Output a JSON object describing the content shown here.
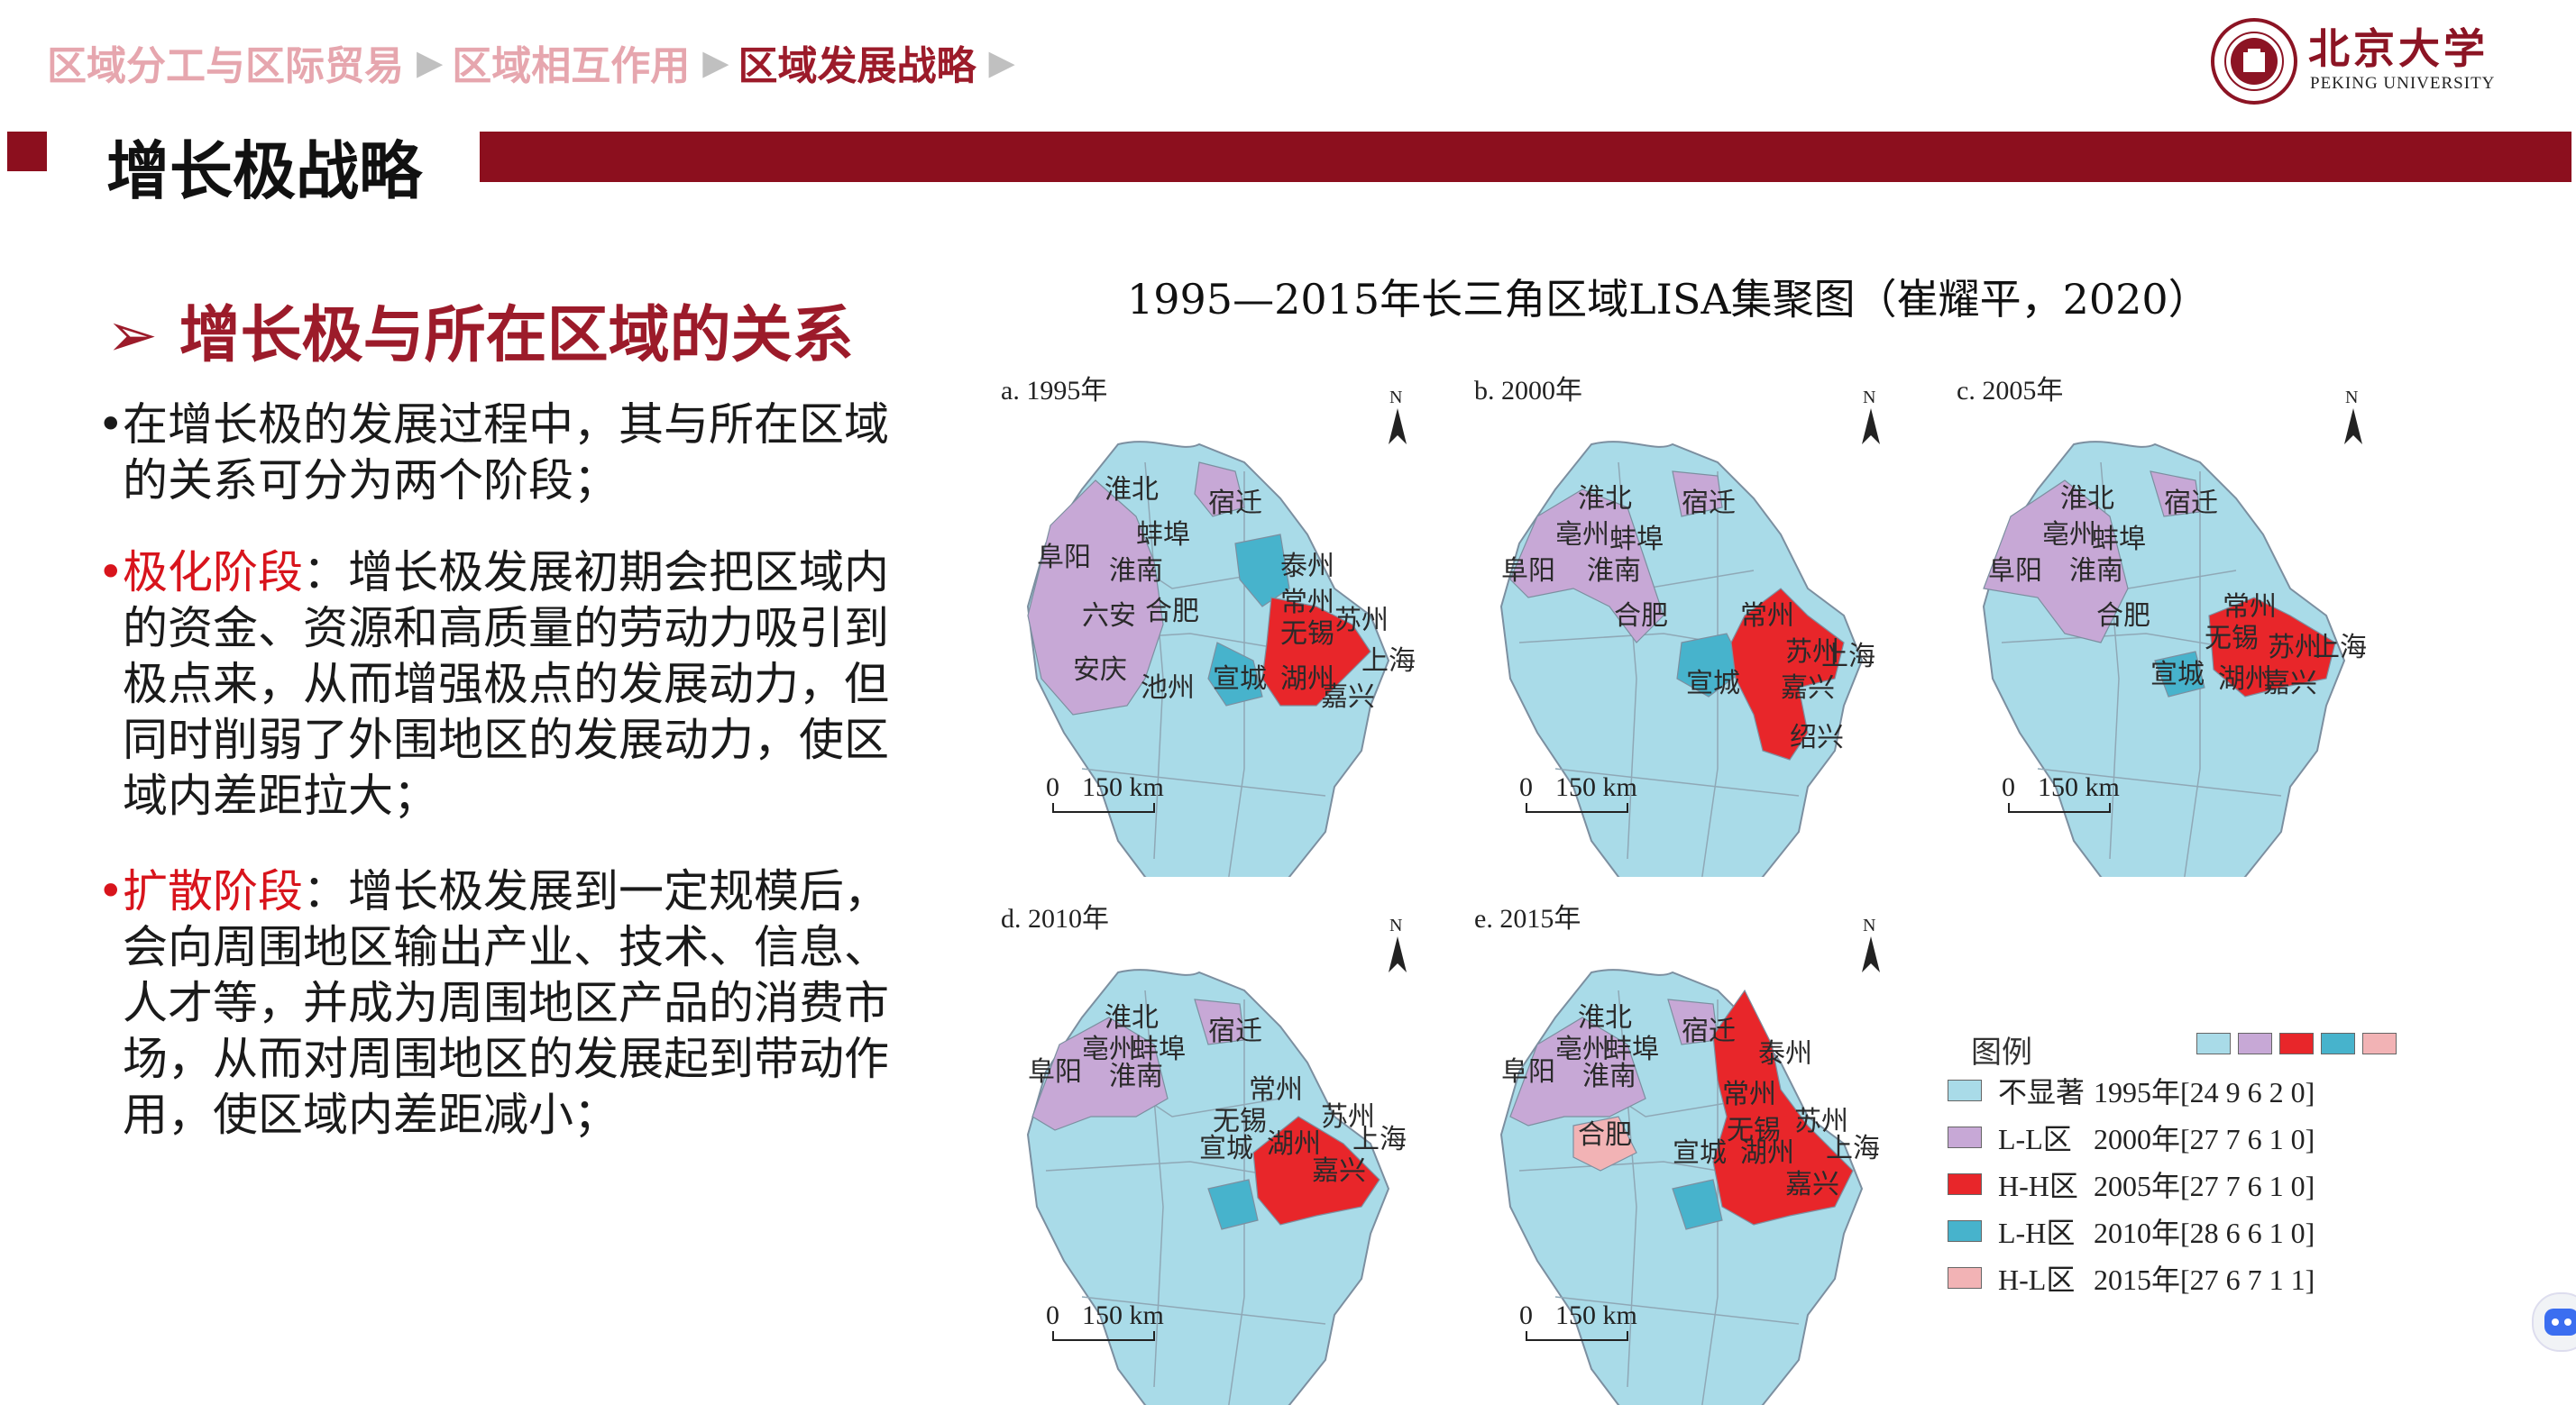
{
  "breadcrumb": {
    "items": [
      "区域分工与区际贸易",
      "区域相互作用",
      "区域发展战略"
    ],
    "arrow": "▶"
  },
  "logo": {
    "text": "北京大学",
    "sub": "PEKING UNIVERSITY"
  },
  "page_title": "增长极战略",
  "section_heading": "➢ 增长极与所在区域的关系",
  "paragraphs": {
    "p1": {
      "bullet": "•",
      "text": "在增长极的发展过程中，其与所在区域的关系可分为两个阶段；"
    },
    "p2": {
      "bullet": "•",
      "keyword": "极化阶段",
      "text": "：增长极发展初期会把区域内的资金、资源和高质量的劳动力吸引到极点来，从而增强极点的发展动力，但同时削弱了外围地区的发展动力，使区域内差距拉大；"
    },
    "p3": {
      "bullet": "•",
      "keyword": "扩散阶段",
      "text": "：增长极发展到一定规模后，会向周围地区输出产业、技术、信息、人才等，并成为周围地区产品的消费市场，从而对周围地区的发展起到带动作用，使区域内差距减小；"
    }
  },
  "figure": {
    "title": "1995—2015年长三角区域LISA集聚图（崔耀平，2020）",
    "north": "N",
    "scale": [
      "0",
      "150 km"
    ],
    "panels": [
      {
        "label": "a. 1995年",
        "cities": [
          "淮北",
          "宿迁",
          "阜阳",
          "蚌埠",
          "淮南",
          "泰州",
          "六安",
          "合肥",
          "常州",
          "苏州",
          "无锡",
          "安庆",
          "池州",
          "宣城",
          "湖州",
          "上海",
          "嘉兴"
        ]
      },
      {
        "label": "b. 2000年",
        "cities": [
          "淮北",
          "宿迁",
          "亳州",
          "蚌埠",
          "阜阳",
          "淮南",
          "合肥",
          "常州",
          "宣城",
          "苏州",
          "上海",
          "嘉兴",
          "绍兴"
        ]
      },
      {
        "label": "c. 2005年",
        "cities": [
          "淮北",
          "宿迁",
          "亳州",
          "蚌埠",
          "阜阳",
          "淮南",
          "合肥",
          "常州",
          "无锡",
          "苏州",
          "上海",
          "宣城",
          "湖州",
          "嘉兴"
        ]
      },
      {
        "label": "d. 2010年",
        "cities": [
          "淮北",
          "宿迁",
          "亳州",
          "蚌埠",
          "阜阳",
          "淮南",
          "常州",
          "无锡",
          "苏州",
          "宣城",
          "湖州",
          "上海",
          "嘉兴"
        ]
      },
      {
        "label": "e. 2015年",
        "cities": [
          "淮北",
          "宿迁",
          "亳州",
          "蚌埠",
          "阜阳",
          "淮南",
          "泰州",
          "合肥",
          "常州",
          "无锡",
          "苏州",
          "宣城",
          "湖州",
          "上海",
          "嘉兴"
        ]
      }
    ]
  },
  "legend": {
    "title": "图例",
    "swatch_colors": [
      "#a9dbe8",
      "#c7a8d6",
      "#e8262a",
      "#47b3cc",
      "#f2b3b5"
    ],
    "rows": [
      {
        "label": "不显著",
        "color": "#a9dbe8",
        "counts": "1995年[24  9  6  2  0]"
      },
      {
        "label": "L-L区",
        "color": "#c7a8d6",
        "counts": "2000年[27  7  6  1  0]"
      },
      {
        "label": "H-H区",
        "color": "#e8262a",
        "counts": "2005年[27  7  6  1  0]"
      },
      {
        "label": "L-H区",
        "color": "#47b3cc",
        "counts": "2010年[28  6  6  1  0]"
      },
      {
        "label": "H-L区",
        "color": "#f2b3b5",
        "counts": "2015年[27  6  7  1  1]"
      }
    ]
  }
}
